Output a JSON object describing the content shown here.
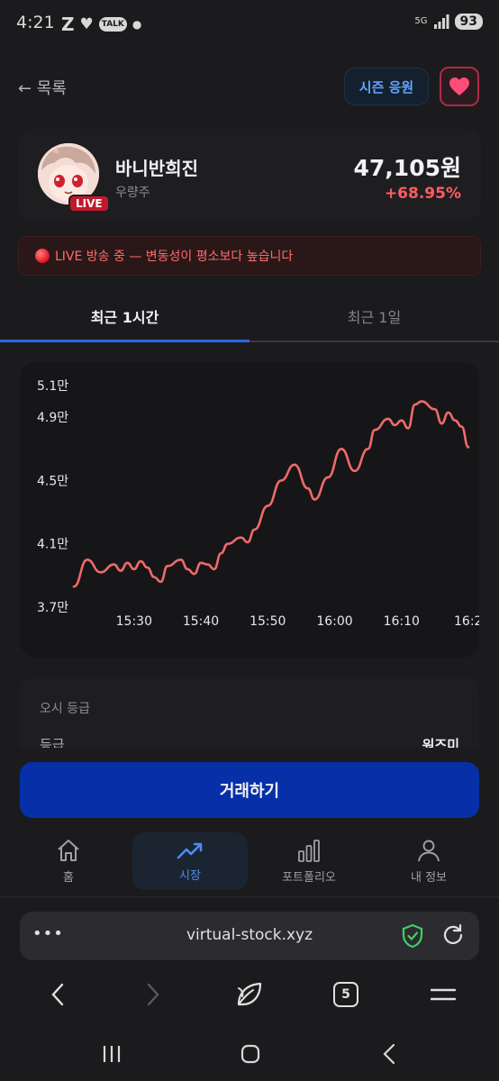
{
  "status_bar": {
    "time": "4:21",
    "network": "5G",
    "battery": "93",
    "talk_label": "TALK"
  },
  "header": {
    "back_label": "← 목록",
    "season_button": "시즌 응원"
  },
  "stock": {
    "name": "바니반희진",
    "category": "우량주",
    "live_badge": "LIVE",
    "price": "47,105원",
    "change": "+68.95%"
  },
  "alert": {
    "text": "LIVE 방송 중 — 변동성이 평소보다 높습니다"
  },
  "tabs": [
    {
      "label": "최근 1시간",
      "active": true
    },
    {
      "label": "최근 1일",
      "active": false
    }
  ],
  "chart_data": {
    "type": "line",
    "y_tick_labels": [
      "5.1만",
      "4.9만",
      "4.5만",
      "4.1만",
      "3.7만"
    ],
    "x_tick_labels": [
      "15:30",
      "15:40",
      "15:50",
      "16:00",
      "16:10",
      "16:2"
    ],
    "ylim": [
      37000,
      51000
    ],
    "series": [
      {
        "color": "#f06a6a",
        "x": [
          "15:21",
          "15:23",
          "15:25",
          "15:27",
          "15:28",
          "15:29",
          "15:30",
          "15:31",
          "15:32",
          "15:33",
          "15:34",
          "15:35",
          "15:37",
          "15:38",
          "15:39",
          "15:40",
          "15:41",
          "15:42",
          "15:43",
          "15:44",
          "15:46",
          "15:47",
          "15:48",
          "15:50",
          "15:52",
          "15:54",
          "15:56",
          "15:57",
          "15:59",
          "16:01",
          "16:03",
          "16:05",
          "16:06",
          "16:08",
          "16:09",
          "16:10",
          "16:11",
          "16:12",
          "16:13",
          "16:15",
          "16:16",
          "16:17",
          "16:18",
          "16:19",
          "16:20"
        ],
        "values": [
          38300,
          40000,
          39200,
          39700,
          39300,
          39800,
          39400,
          39900,
          39500,
          38900,
          38600,
          39600,
          40000,
          39400,
          39100,
          39800,
          39700,
          39400,
          40400,
          41000,
          41400,
          41100,
          41900,
          43400,
          45000,
          46000,
          44500,
          43800,
          45200,
          47000,
          45600,
          47000,
          48200,
          48900,
          48500,
          48800,
          48300,
          49800,
          50000,
          49500,
          48600,
          49300,
          48800,
          48400,
          47105
        ]
      }
    ],
    "grid": false,
    "legend": "none"
  },
  "grade": {
    "title": "오시 등급",
    "label": "등급",
    "value": "워즈미"
  },
  "trade_button": "거래하기",
  "bottom_nav": [
    {
      "label": "홈",
      "icon": "home-icon"
    },
    {
      "label": "시장",
      "icon": "trending-up-icon"
    },
    {
      "label": "포트폴리오",
      "icon": "bar-chart-icon"
    },
    {
      "label": "내 정보",
      "icon": "user-icon"
    }
  ],
  "browser": {
    "more": "•••",
    "url": "virtual-stock.xyz",
    "tab_count": "5"
  },
  "colors": {
    "accent_blue": "#0730a8",
    "up_red": "#ff5c61",
    "active_nav": "#4d8cf5"
  }
}
